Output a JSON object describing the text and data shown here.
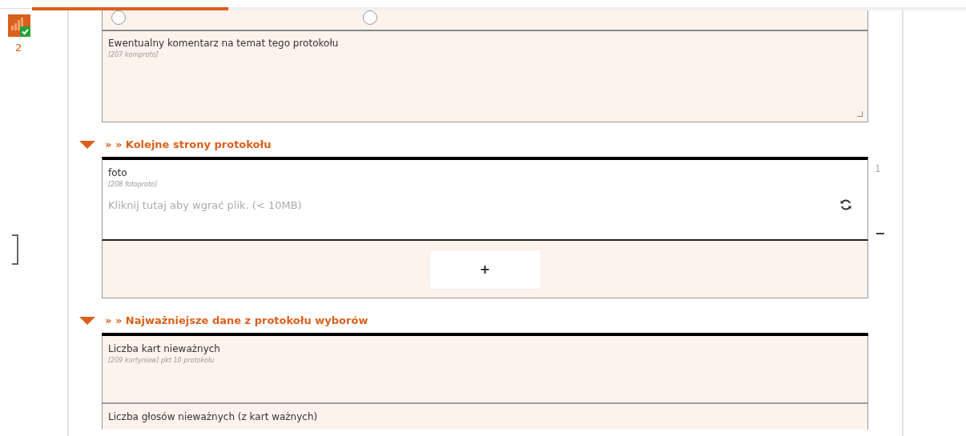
{
  "sidebar": {
    "badge_count": "2",
    "status_checked": true
  },
  "progress": {
    "level": 0.21
  },
  "radio_options": [
    {
      "selected": false
    },
    {
      "selected": false
    }
  ],
  "comment_field": {
    "label": "Ewentualny komentarz na temat tego protokołu",
    "hint": "[207 komproto]"
  },
  "sections": [
    {
      "title": "» » Kolejne strony protokołu",
      "expanded": true,
      "kind": "upload",
      "items": [
        {
          "label": "foto",
          "hint": "[208 fotoproto]",
          "placeholder": "Kliknij tutaj aby wgrać plik. (< 10MB)",
          "number": "1",
          "remove": "−"
        }
      ],
      "add_button": "+"
    },
    {
      "title": "» » Najważniejsze dane z protokołu wyborów",
      "expanded": true,
      "kind": "fields",
      "items": [
        {
          "label": "Liczba kart nieważnych",
          "hint": "[209 kartyniew] pkt 10 protokołu"
        },
        {
          "label": "Liczba głosów nieważnych (z kart ważnych)"
        }
      ]
    }
  ]
}
